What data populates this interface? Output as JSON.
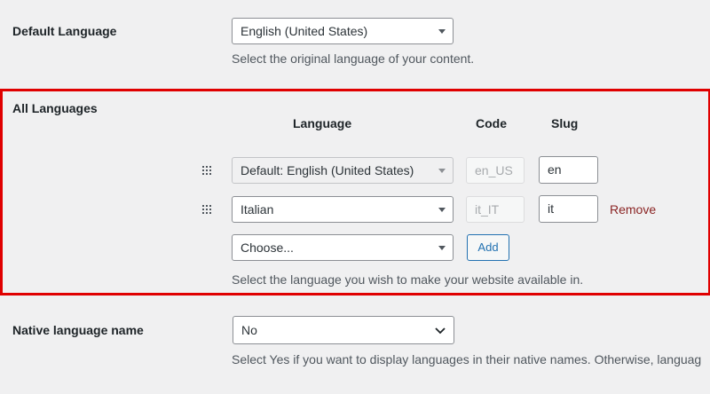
{
  "default_language": {
    "label": "Default Language",
    "selected": "English (United States)",
    "description": "Select the original language of your content."
  },
  "all_languages": {
    "label": "All Languages",
    "columns": {
      "language": "Language",
      "code": "Code",
      "slug": "Slug"
    },
    "rows": [
      {
        "language": "Default: English (United States)",
        "code": "en_US",
        "slug": "en",
        "disabled": true
      },
      {
        "language": "Italian",
        "code": "it_IT",
        "slug": "it",
        "remove_label": "Remove"
      }
    ],
    "choose": {
      "placeholder": "Choose...",
      "add_label": "Add"
    },
    "description": "Select the language you wish to make your website available in."
  },
  "native_language_name": {
    "label": "Native language name",
    "selected": "No",
    "description": "Select Yes if you want to display languages in their native names. Otherwise, languag"
  },
  "colors": {
    "highlight": "#e00000",
    "remove": "#8a2424",
    "accent": "#2271b1"
  },
  "icons": {
    "drag": "drag-handle-icon",
    "caret": "caret-down-icon",
    "chevron": "chevron-down-icon"
  }
}
